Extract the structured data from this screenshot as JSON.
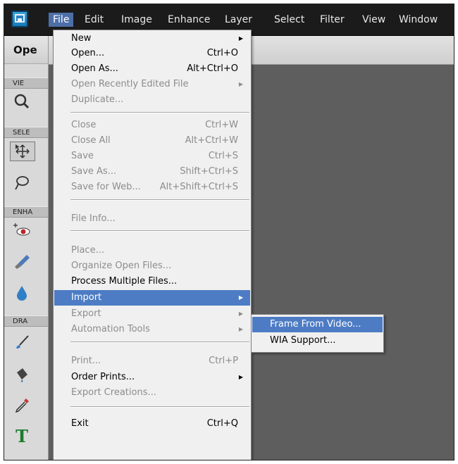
{
  "menubar": {
    "items": [
      "File",
      "Edit",
      "Image",
      "Enhance",
      "Layer",
      "Select",
      "Filter",
      "View",
      "Window"
    ],
    "active": "File"
  },
  "panel": {
    "header": "Ope",
    "sections": [
      "VIE",
      "SELE",
      "ENHA",
      "DRA"
    ]
  },
  "file_menu": {
    "items": [
      {
        "label": "New",
        "shortcut": "",
        "submenu": true,
        "enabled": true
      },
      {
        "label": "Open...",
        "shortcut": "Ctrl+O",
        "submenu": false,
        "enabled": true
      },
      {
        "label": "Open As...",
        "shortcut": "Alt+Ctrl+O",
        "submenu": false,
        "enabled": true
      },
      {
        "label": "Open Recently Edited File",
        "shortcut": "",
        "submenu": true,
        "enabled": false
      },
      {
        "label": "Duplicate...",
        "shortcut": "",
        "submenu": false,
        "enabled": false
      },
      {
        "label": "Close",
        "shortcut": "Ctrl+W",
        "submenu": false,
        "enabled": false
      },
      {
        "label": "Close All",
        "shortcut": "Alt+Ctrl+W",
        "submenu": false,
        "enabled": false
      },
      {
        "label": "Save",
        "shortcut": "Ctrl+S",
        "submenu": false,
        "enabled": false
      },
      {
        "label": "Save As...",
        "shortcut": "Shift+Ctrl+S",
        "submenu": false,
        "enabled": false
      },
      {
        "label": "Save for Web...",
        "shortcut": "Alt+Shift+Ctrl+S",
        "submenu": false,
        "enabled": false
      },
      {
        "label": "File Info...",
        "shortcut": "",
        "submenu": false,
        "enabled": false
      },
      {
        "label": "Place...",
        "shortcut": "",
        "submenu": false,
        "enabled": false
      },
      {
        "label": "Organize Open Files...",
        "shortcut": "",
        "submenu": false,
        "enabled": false
      },
      {
        "label": "Process Multiple Files...",
        "shortcut": "",
        "submenu": false,
        "enabled": true
      },
      {
        "label": "Import",
        "shortcut": "",
        "submenu": true,
        "enabled": true,
        "highlighted": true
      },
      {
        "label": "Export",
        "shortcut": "",
        "submenu": true,
        "enabled": false
      },
      {
        "label": "Automation Tools",
        "shortcut": "",
        "submenu": true,
        "enabled": false
      },
      {
        "label": "Print...",
        "shortcut": "Ctrl+P",
        "submenu": false,
        "enabled": false
      },
      {
        "label": "Order Prints...",
        "shortcut": "",
        "submenu": true,
        "enabled": true
      },
      {
        "label": "Export Creations...",
        "shortcut": "",
        "submenu": false,
        "enabled": false
      },
      {
        "label": "Exit",
        "shortcut": "Ctrl+Q",
        "submenu": false,
        "enabled": true
      }
    ]
  },
  "import_submenu": {
    "items": [
      {
        "label": "Frame From Video...",
        "highlighted": true
      },
      {
        "label": "WIA Support...",
        "highlighted": false
      }
    ]
  },
  "tools": [
    "zoom-icon",
    "move-icon",
    "lasso-icon",
    "red-eye-icon",
    "healing-brush-icon",
    "blur-icon",
    "brush-icon",
    "paint-bucket-icon",
    "eyedropper-icon",
    "type-icon"
  ]
}
